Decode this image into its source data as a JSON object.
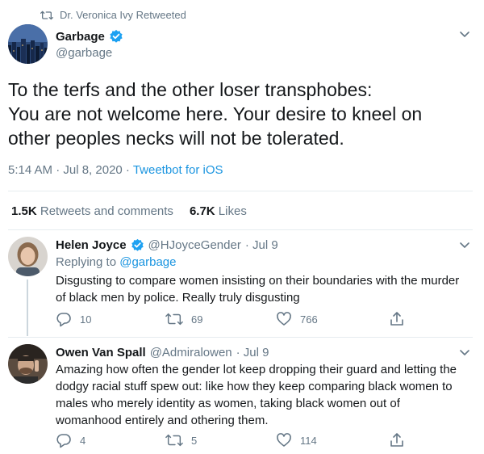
{
  "retweet_header": {
    "text": "Dr. Veronica Ivy Retweeted",
    "icon": "retweet-icon"
  },
  "main_tweet": {
    "name": "Garbage",
    "handle": "@garbage",
    "verified": true,
    "lines": [
      "To the terfs and the other loser transphobes:",
      "You are not welcome here. Your desire to kneel on",
      "other peoples necks will not be tolerated."
    ],
    "time": "5:14 AM · Jul 8, 2020 · ",
    "source": "Tweetbot for iOS",
    "retweets_count": "1.5K",
    "retweets_label": "Retweets and comments",
    "likes_count": "6.7K",
    "likes_label": "Likes"
  },
  "replies": [
    {
      "name": "Helen Joyce",
      "verified": true,
      "handle": "@HJoyceGender",
      "date": "· Jul 9",
      "replying_label": "Replying to ",
      "replying_to": "@garbage",
      "lines": [
        "Disgusting to compare women insisting on their boundaries with the murder",
        "of black men by police. Really truly disgusting"
      ],
      "reply_count": "10",
      "retweet_count": "69",
      "like_count": "766"
    },
    {
      "name": "Owen Van Spall",
      "verified": false,
      "handle": "@Admiralowen",
      "date": "· Jul 9",
      "lines": [
        "Amazing how often the gender lot keep dropping their guard and letting the",
        "dodgy racial stuff spew out: like how they keep comparing black women to",
        "males who merely identity as women, taking black women out of",
        "womanhood entirely and othering them."
      ],
      "reply_count": "4",
      "retweet_count": "5",
      "like_count": "114"
    }
  ],
  "colors": {
    "accent": "#1b95e0",
    "muted": "#657786",
    "text": "#14171a",
    "divider": "#e6ecf0"
  }
}
